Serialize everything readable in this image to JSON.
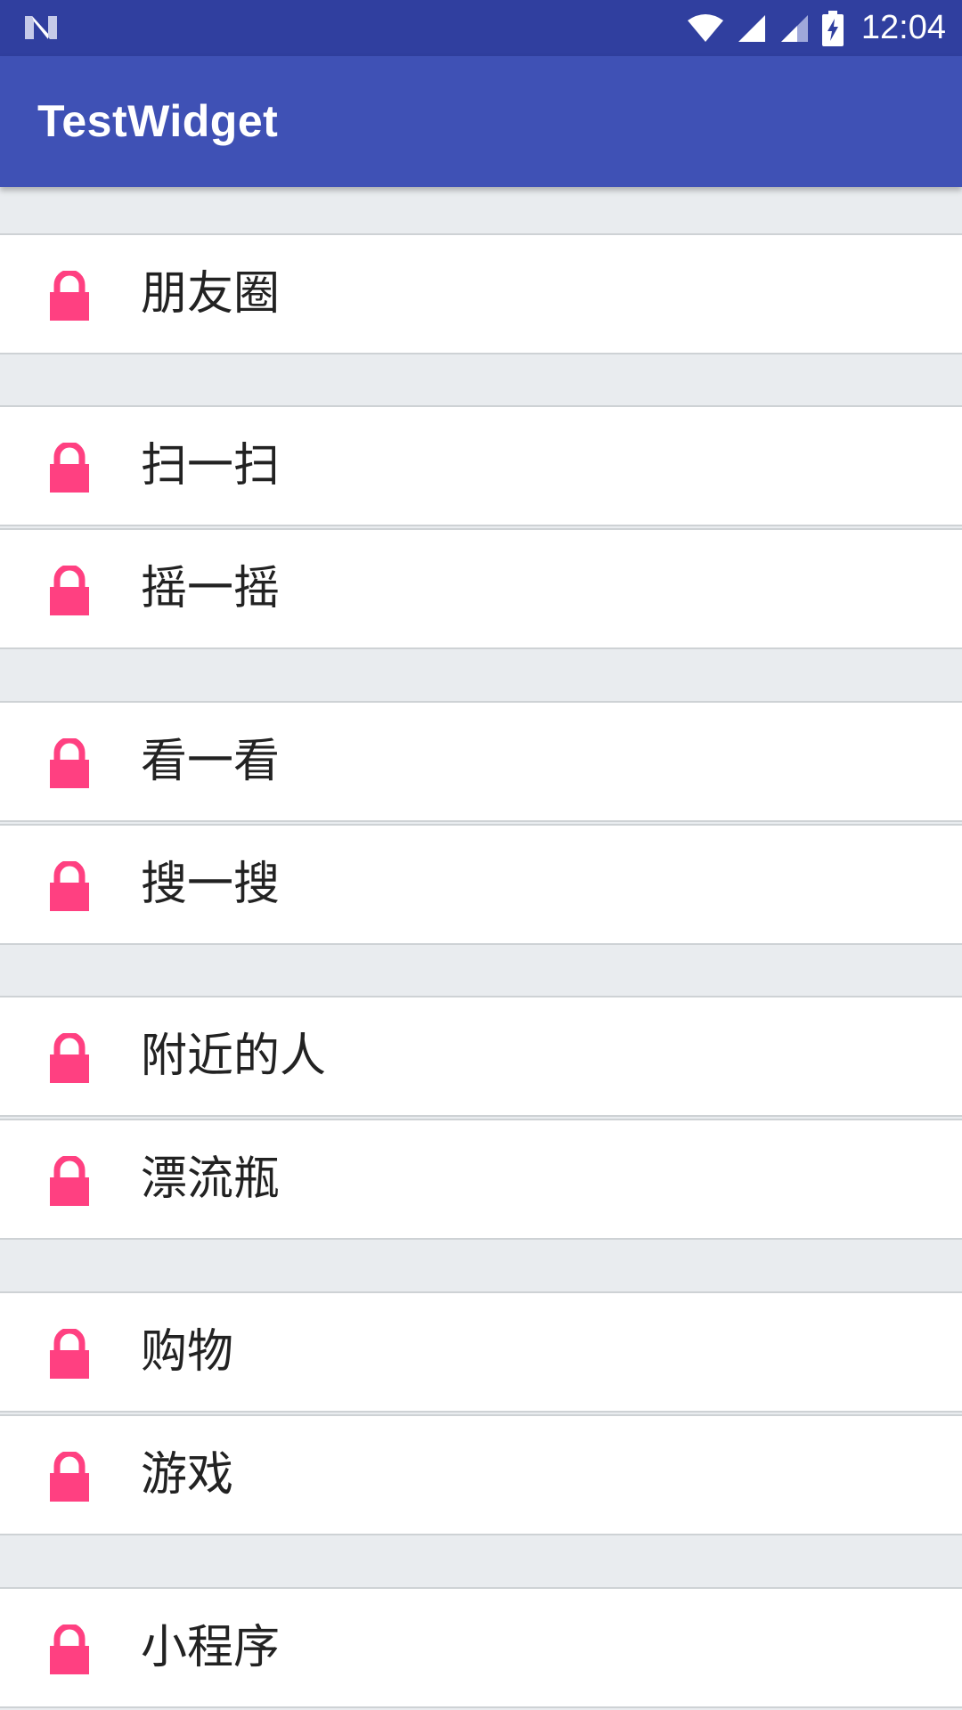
{
  "status_bar": {
    "time": "12:04",
    "icons": [
      "n-logo-icon",
      "wifi-icon",
      "signal-icon",
      "signal-icon-2",
      "battery-charging-icon"
    ]
  },
  "app_bar": {
    "title": "TestWidget"
  },
  "colors": {
    "status_bar": "#303F9F",
    "app_bar": "#3F51B5",
    "lock_icon": "#FF4081",
    "divider": "#CED2D5",
    "background": "#E9ECEF"
  },
  "menu": {
    "items": [
      {
        "label": "朋友圈",
        "icon": "lock-icon"
      },
      {
        "label": "扫一扫",
        "icon": "lock-icon"
      },
      {
        "label": "摇一摇",
        "icon": "lock-icon"
      },
      {
        "label": "看一看",
        "icon": "lock-icon"
      },
      {
        "label": "搜一搜",
        "icon": "lock-icon"
      },
      {
        "label": "附近的人",
        "icon": "lock-icon"
      },
      {
        "label": "漂流瓶",
        "icon": "lock-icon"
      },
      {
        "label": "购物",
        "icon": "lock-icon"
      },
      {
        "label": "游戏",
        "icon": "lock-icon"
      },
      {
        "label": "小程序",
        "icon": "lock-icon"
      }
    ]
  }
}
